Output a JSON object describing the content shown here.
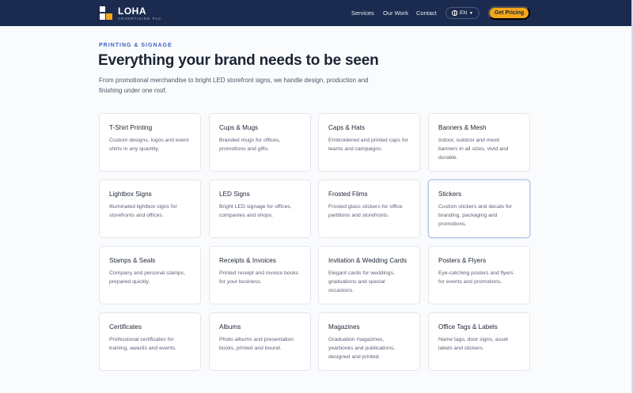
{
  "header": {
    "brand": "LOHA",
    "brand_sub": "ADVERTISING PLC",
    "nav": [
      "Services",
      "Our Work",
      "Contact"
    ],
    "language": "EN",
    "cta": "Get Pricing"
  },
  "hero": {
    "eyebrow": "PRINTING & SIGNAGE",
    "title": "Everything your brand needs to be seen",
    "description": "From promotional merchandise to bright LED storefront signs, we handle design, production and finishing under one roof."
  },
  "services": [
    {
      "title": "T-Shirt Printing",
      "desc": "Custom designs, logos and event shirts in any quantity."
    },
    {
      "title": "Cups & Mugs",
      "desc": "Branded mugs for offices, promotions and gifts."
    },
    {
      "title": "Caps & Hats",
      "desc": "Embroidered and printed caps for teams and campaigns."
    },
    {
      "title": "Banners & Mesh",
      "desc": "Indoor, outdoor and mesh banners in all sizes, vivid and durable."
    },
    {
      "title": "Lightbox Signs",
      "desc": "Illuminated lightbox signs for storefronts and offices."
    },
    {
      "title": "LED Signs",
      "desc": "Bright LED signage for offices, companies and shops."
    },
    {
      "title": "Frosted Films",
      "desc": "Frosted glass stickers for office partitions and storefronts."
    },
    {
      "title": "Stickers",
      "desc": "Custom stickers and decals for branding, packaging and promotions."
    },
    {
      "title": "Stamps & Seals",
      "desc": "Company and personal stamps, prepared quickly."
    },
    {
      "title": "Receipts & Invoices",
      "desc": "Printed receipt and invoice books for your business."
    },
    {
      "title": "Invitation & Wedding Cards",
      "desc": "Elegant cards for weddings, graduations and special occasions."
    },
    {
      "title": "Posters & Flyers",
      "desc": "Eye-catching posters and flyers for events and promotions."
    },
    {
      "title": "Certificates",
      "desc": "Professional certificates for training, awards and events."
    },
    {
      "title": "Albums",
      "desc": "Photo albums and presentation books, printed and bound."
    },
    {
      "title": "Magazines",
      "desc": "Graduation magazines, yearbooks and publications, designed and printed."
    },
    {
      "title": "Office Tags & Labels",
      "desc": "Name tags, door signs, asset labels and stickers."
    }
  ],
  "colors": {
    "header_bg": "#1b2b4f",
    "accent": "#f4a61d",
    "eyebrow": "#3d63c7"
  },
  "icons": {
    "language": "globe-icon",
    "language_dropdown": "chevron-down-icon"
  }
}
